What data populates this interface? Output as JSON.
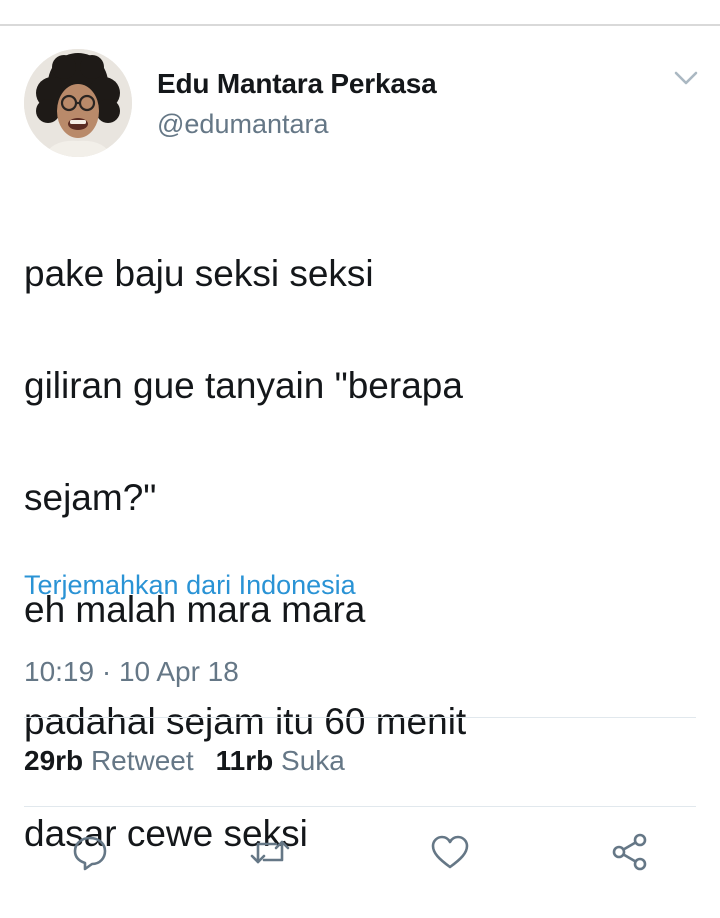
{
  "author": {
    "display_name": "Edu Mantara Perkasa",
    "handle": "@edumantara",
    "avatar_icon": "profile-photo"
  },
  "menu": {
    "icon": "chevron-down-icon"
  },
  "tweet": {
    "lines": [
      "pake baju seksi seksi",
      "giliran gue tanyain \"berapa",
      "sejam?\"",
      "eh malah mara mara",
      "padahal sejam itu 60 menit",
      "dasar cewe seksi"
    ],
    "translate_label": "Terjemahkan dari Indonesia",
    "timestamp": "10:19 · 10 Apr 18"
  },
  "stats": {
    "retweet_count": "29rb",
    "retweet_label": "Retweet",
    "like_count": "11rb",
    "like_label": "Suka"
  },
  "actions": [
    {
      "icon": "reply-icon"
    },
    {
      "icon": "retweet-icon"
    },
    {
      "icon": "like-icon"
    },
    {
      "icon": "share-icon"
    }
  ],
  "colors": {
    "text": "#14171a",
    "secondary": "#657786",
    "link": "#2a93d5",
    "divider": "#e1e8ed"
  }
}
